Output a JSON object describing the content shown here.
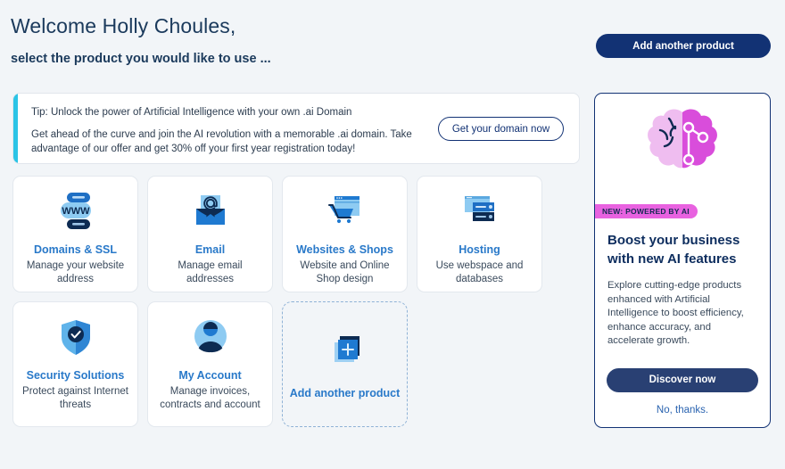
{
  "header": {
    "welcome": "Welcome Holly Choules,",
    "subtitle": "select the product you would like to use ...",
    "add_product_button": "Add another product"
  },
  "banner": {
    "title": "Tip: Unlock the power of Artificial Intelligence with your own .ai Domain",
    "text": "Get ahead of the curve and join the AI revolution with a memorable .ai domain. Take advantage of our offer and get 30% off your first year registration today!",
    "button": "Get your domain now",
    "accent_color": "#2bc4e6"
  },
  "products": [
    [
      {
        "icon": "www-domains-icon",
        "title": "Domains & SSL",
        "desc": "Manage your website address"
      },
      {
        "icon": "envelope-at-icon",
        "title": "Email",
        "desc": "Manage email addresses"
      },
      {
        "icon": "shopping-cart-browser-icon",
        "title": "Websites & Shops",
        "desc": "Website and Online Shop design"
      },
      {
        "icon": "server-stack-icon",
        "title": "Hosting",
        "desc": "Use webspace and databases"
      }
    ],
    [
      {
        "icon": "shield-check-icon",
        "title": "Security Solutions",
        "desc": "Protect against Internet threats"
      },
      {
        "icon": "user-avatar-icon",
        "title": "My Account",
        "desc": "Manage invoices, contracts and account"
      },
      {
        "icon": "plus-squares-icon",
        "title": "Add another product",
        "desc": ""
      }
    ]
  ],
  "promo": {
    "art_icon": "ai-brain-icon",
    "badge": "NEW: POWERED BY AI",
    "heading": "Boost your business with new AI features",
    "body": "Explore cutting-edge products enhanced with Artificial Intelligence to boost efficiency, enhance accuracy, and accelerate growth.",
    "primary_button": "Discover now",
    "dismiss_link": "No, thanks.",
    "badge_color": "#e862e0",
    "border_color": "#123274"
  },
  "theme": {
    "page_background": "#f2f5f8",
    "navy": "#123274",
    "accent_blue": "#2979c9"
  }
}
